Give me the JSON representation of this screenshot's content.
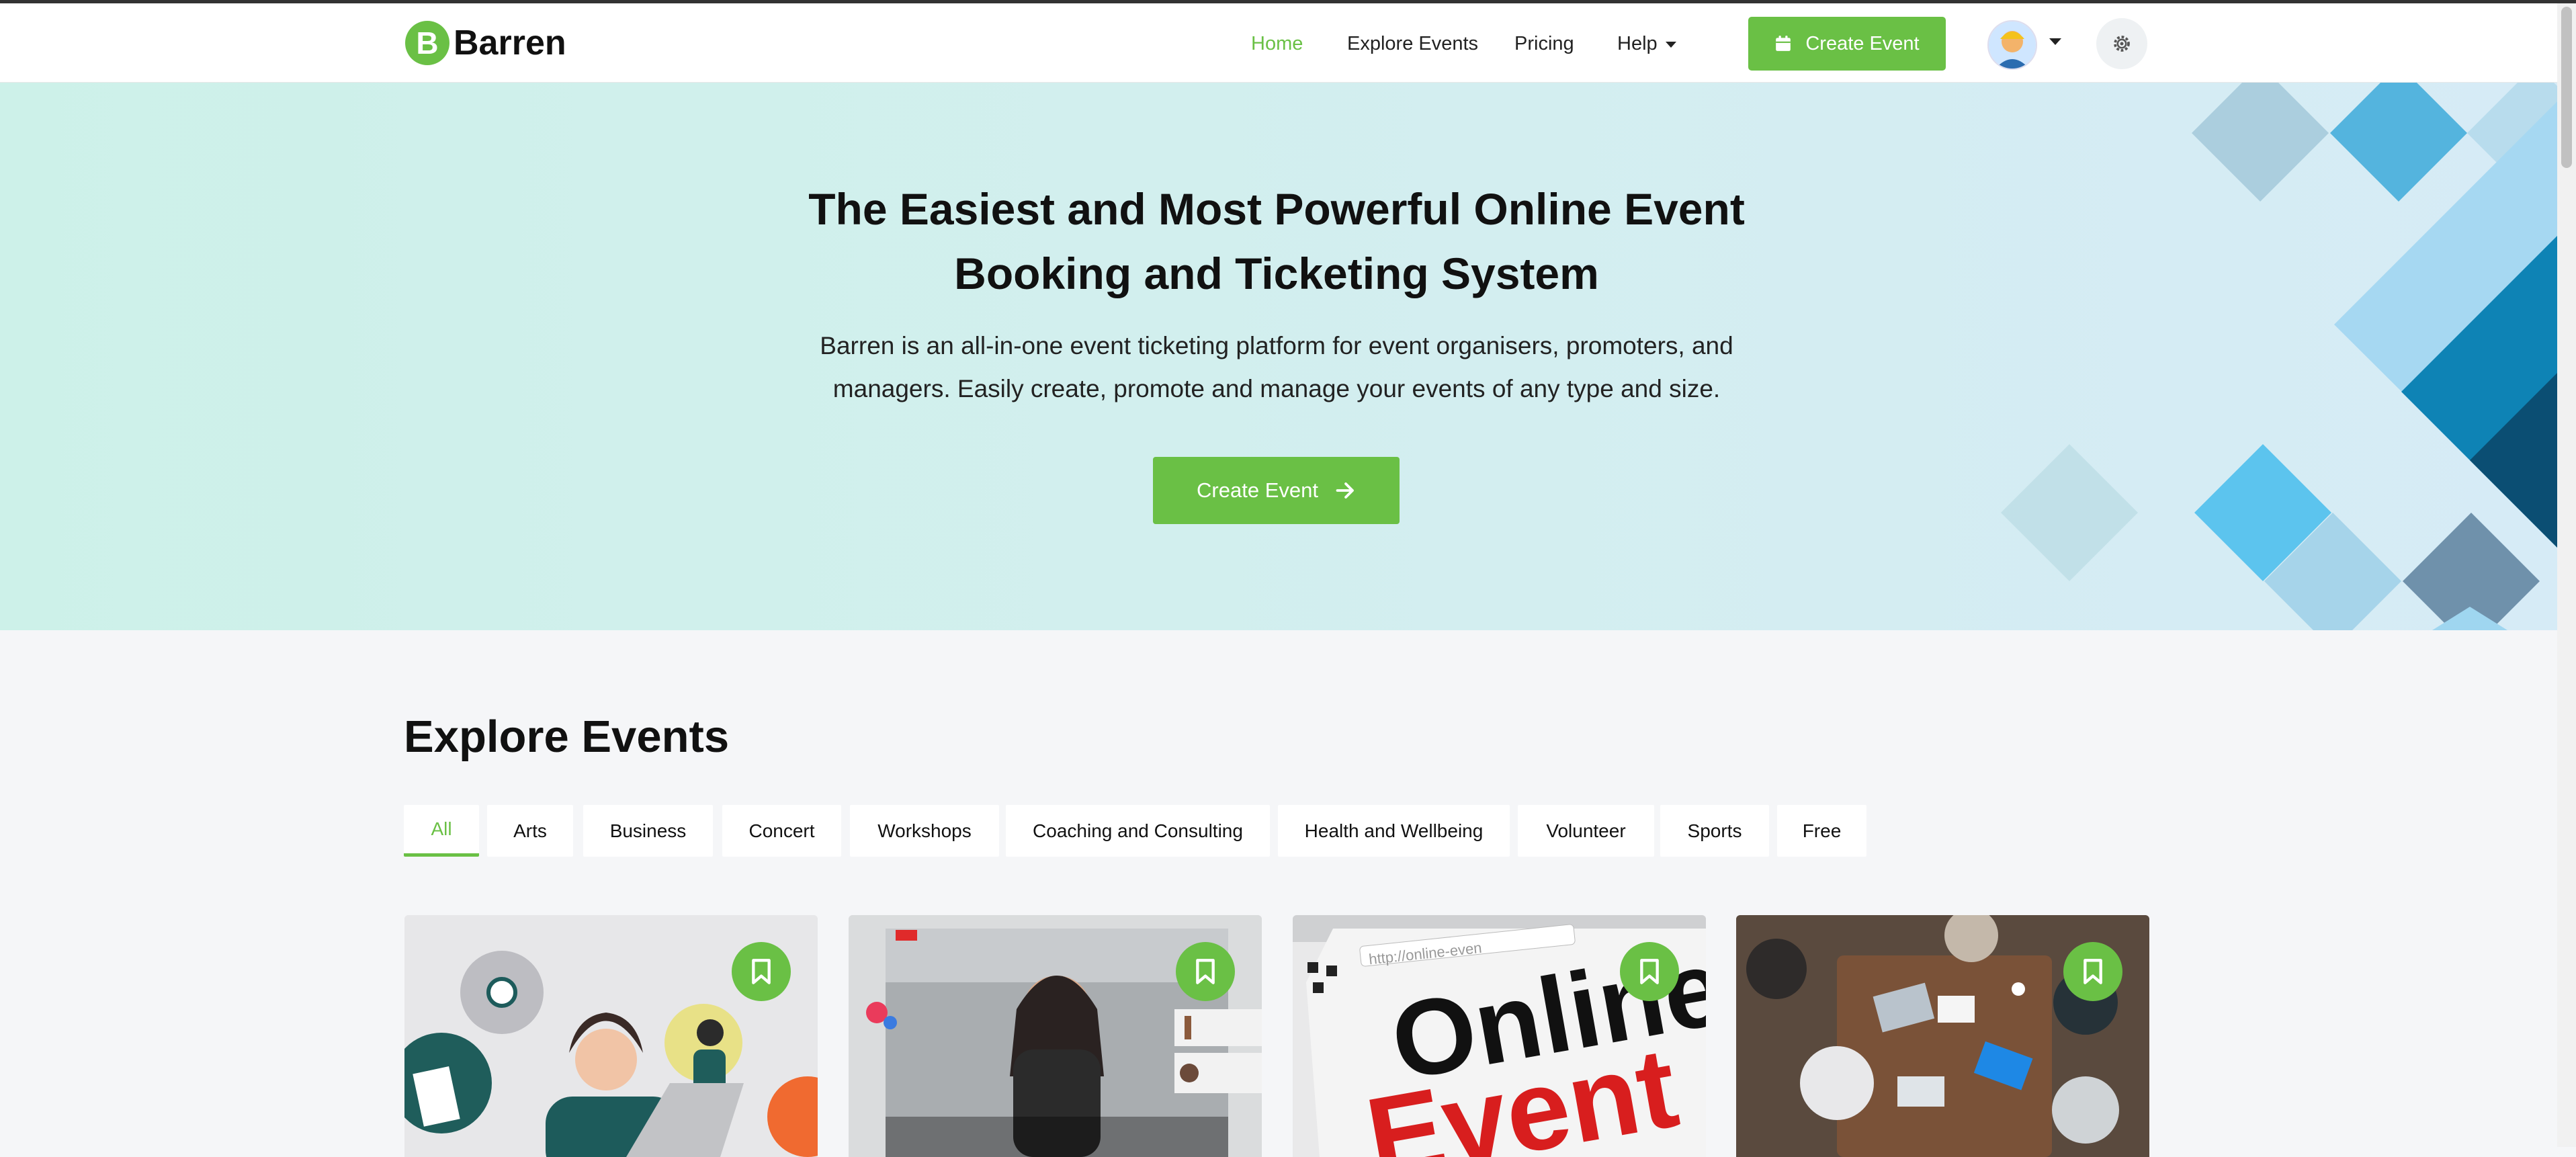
{
  "brand": {
    "logo_letter": "B",
    "name": "Barren",
    "accent": "#6ac045"
  },
  "nav": {
    "links": [
      "Home",
      "Explore Events",
      "Pricing",
      "Help"
    ],
    "active": "Home",
    "create_button": "Create Event",
    "icons": {
      "create": "calendar-icon",
      "theme": "gear-icon",
      "dropdown": "caret-down-icon"
    }
  },
  "hero": {
    "title": "The Easiest and Most Powerful Online Event Booking and Ticketing System",
    "subtitle": "Barren is an all-in-one event ticketing platform for event organisers, promoters, and managers. Easily create, promote and manage your events of any type and size.",
    "button": "Create Event",
    "button_icon": "arrow-right-icon"
  },
  "explore": {
    "title": "Explore Events",
    "tabs": [
      "All",
      "Arts",
      "Business",
      "Concert",
      "Workshops",
      "Coaching and Consulting",
      "Health and Wellbeing",
      "Volunteer",
      "Sports",
      "Free"
    ],
    "active_tab": "All"
  },
  "cards": [
    {
      "image": "online-meeting-illustration",
      "bookmark_icon": "bookmark-icon"
    },
    {
      "image": "live-stream-makeup-tutorial",
      "bookmark_icon": "bookmark-icon"
    },
    {
      "image": "online-event-text-graphic",
      "image_text": [
        "Online",
        "Event"
      ],
      "url_text": "http://online-even",
      "bookmark_icon": "bookmark-icon"
    },
    {
      "image": "team-meeting-top-view",
      "bookmark_icon": "bookmark-icon"
    }
  ]
}
